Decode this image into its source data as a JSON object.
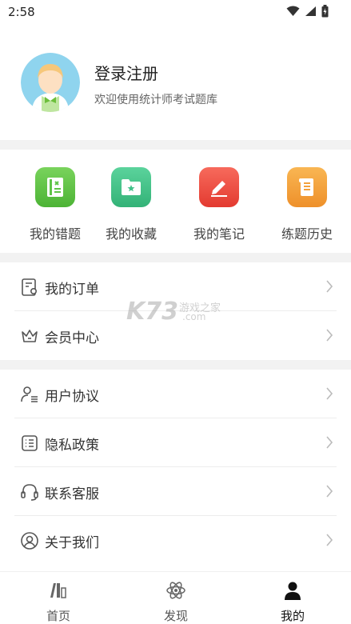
{
  "status_bar": {
    "time": "2:58"
  },
  "profile": {
    "title": "登录注册",
    "subtitle": "欢迎使用统计师考试题库"
  },
  "quick_actions": [
    {
      "label": "我的错题",
      "icon": "mistakes-book-icon",
      "color": "#5fc447"
    },
    {
      "label": "我的收藏",
      "icon": "favorites-folder-icon",
      "color": "#43c18a"
    },
    {
      "label": "我的笔记",
      "icon": "notes-pen-icon",
      "color": "#f0473f"
    },
    {
      "label": "练题历史",
      "icon": "history-scroll-icon",
      "color": "#f3a13b"
    }
  ],
  "menu_group1": [
    {
      "label": "我的订单",
      "icon": "order-icon"
    },
    {
      "label": "会员中心",
      "icon": "crown-icon"
    }
  ],
  "menu_group2": [
    {
      "label": "用户协议",
      "icon": "user-agreement-icon"
    },
    {
      "label": "隐私政策",
      "icon": "privacy-list-icon"
    },
    {
      "label": "联系客服",
      "icon": "headset-icon"
    },
    {
      "label": "关于我们",
      "icon": "about-user-icon"
    }
  ],
  "watermark": {
    "text_main": "K73",
    "text_cn": "游戏之家",
    "text_url": ".com"
  },
  "tabs": [
    {
      "label": "首页",
      "icon": "home-books-icon",
      "active": false
    },
    {
      "label": "发现",
      "icon": "discover-atom-icon",
      "active": false
    },
    {
      "label": "我的",
      "icon": "profile-person-icon",
      "active": true
    }
  ]
}
